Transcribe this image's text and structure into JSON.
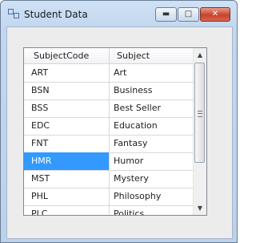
{
  "window": {
    "title": "Student Data",
    "minimize_glyph": "▬",
    "maximize_glyph": "□",
    "close_glyph": "✕"
  },
  "grid": {
    "columns": [
      "SubjectCode",
      "Subject"
    ],
    "rows": [
      {
        "code": "ART",
        "subject": "Art"
      },
      {
        "code": "BSN",
        "subject": "Business"
      },
      {
        "code": "BSS",
        "subject": "Best Seller"
      },
      {
        "code": "EDC",
        "subject": "Education"
      },
      {
        "code": "FNT",
        "subject": "Fantasy"
      },
      {
        "code": "HMR",
        "subject": "Humor"
      },
      {
        "code": "MST",
        "subject": "Mystery"
      },
      {
        "code": "PHL",
        "subject": "Philosophy"
      },
      {
        "code": "PLC",
        "subject": "Politics"
      }
    ],
    "selected_row": 5
  },
  "scrollbar": {
    "up_glyph": "▲",
    "down_glyph": "▼"
  },
  "colors": {
    "selection": "#3399ff",
    "close_button": "#c7432c"
  }
}
